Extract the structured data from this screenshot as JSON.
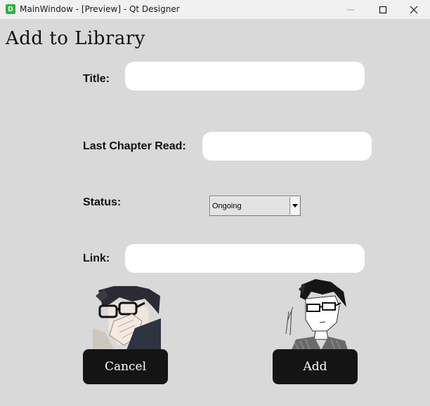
{
  "window": {
    "app_icon_letter": "D",
    "title": "MainWindow - [Preview] - Qt Designer",
    "controls": [
      "minimize-icon",
      "maximize-icon",
      "close-icon"
    ]
  },
  "form": {
    "heading": "Add to Library",
    "title_label": "Title:",
    "title_value": "",
    "last_chapter_label": "Last Chapter Read:",
    "last_chapter_value": "",
    "status_label": "Status:",
    "status_selected": "Ongoing",
    "link_label": "Link:",
    "link_value": ""
  },
  "buttons": {
    "cancel": "Cancel",
    "add": "Add"
  },
  "colors": {
    "background": "#d9d9d9",
    "button_bg": "#141414",
    "button_text": "#ffffff",
    "field_bg": "#ffffff",
    "app_icon": "#2fb344"
  }
}
